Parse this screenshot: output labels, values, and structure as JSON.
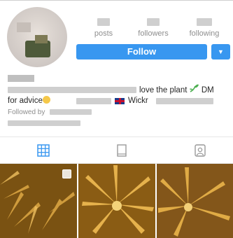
{
  "stats": {
    "posts_label": "posts",
    "followers_label": "followers",
    "following_label": "following"
  },
  "actions": {
    "follow_label": "Follow",
    "menu_glyph": "▼"
  },
  "bio": {
    "line1_text": "love the plant",
    "line1_text_b": "DM",
    "line2_text_a": "for advice",
    "line2_text_b": "Wickr",
    "followed_by_label": "Followed by"
  },
  "icons": [
    "leaf-icon",
    "smile-emoji-icon",
    "uk-flag-icon",
    "grid-icon",
    "feed-icon",
    "tagged-icon",
    "multiple-photos-icon"
  ],
  "colors": {
    "follow_blue": "#3897f0",
    "tab_active": "#3897f0",
    "muted_text": "#8e8e8e"
  }
}
